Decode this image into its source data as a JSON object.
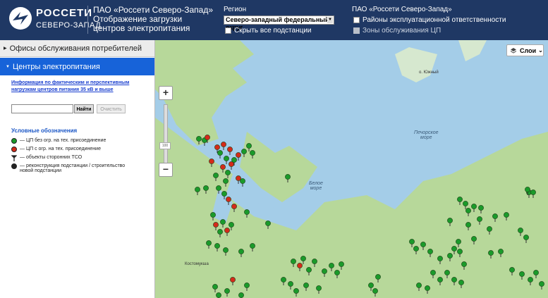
{
  "header": {
    "brand": "РОССЕТИ",
    "brand_sub": "СЕВЕРО-ЗАПАД",
    "org": "ПАО «Россети Северо-Запад»",
    "title_line1": "Отображение загрузки",
    "title_line2": "центров электропитания",
    "region_label": "Регион",
    "region_value": "Северо-западный федеральный округ",
    "hide_all_label": "Скрыть все подстанции",
    "org_right": "ПАО «Россети Северо-Запад»",
    "districts_label": "Районы эксплуатационной ответственности",
    "zones_label": "Зоны обслуживания ЦП"
  },
  "sidebar": {
    "offices_label": "Офисы обслуживания потребителей",
    "centers_label": "Центры электропитания",
    "info_link": "Информация по фактическим и перспективным нагрузкам центров питания 35 кВ и выше",
    "search_placeholder": "",
    "find_button": "Найти",
    "clear_button": "Очистить",
    "legend_title": "Условные обозначения",
    "legend": [
      {
        "text": "— ЦП без огр. на тех. присоединение",
        "color": "#1a9a2a"
      },
      {
        "text": "— ЦП с огр. на тех. присоединение",
        "color": "#d42a1a"
      },
      {
        "text": "— объекты сторонних ТСО",
        "color": "#222222"
      },
      {
        "text": "— реконструкция подстанции / строительство новой подстанции",
        "color": "#222222"
      }
    ]
  },
  "map": {
    "layers_label": "Слои",
    "zoom_in": "+",
    "zoom_out": "−",
    "zoom_level": "100",
    "labels": {
      "white_sea": "Белое\nморе",
      "pechora_sea": "Печорское\nморе",
      "yuzhny": "о. Южный",
      "kostomuksha": "Костомукша"
    },
    "colors": {
      "header": "#1f3864",
      "accent": "#1763d9",
      "sea": "#a4cde8",
      "land": "#b7d89a",
      "marker_ok": "#1a9a2a",
      "marker_limit": "#d42a1a"
    }
  }
}
